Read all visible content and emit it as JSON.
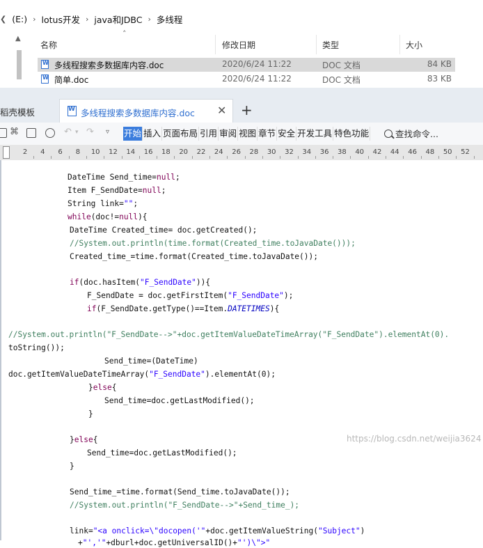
{
  "explorer": {
    "breadcrumb": [
      "(E:)",
      "lotus开发",
      "java和JDBC",
      "多线程"
    ],
    "columns": {
      "name": "名称",
      "date": "修改日期",
      "type": "类型",
      "size": "大小"
    },
    "files": [
      {
        "name": "多线程搜索多数据库内容.doc",
        "date": "2020/6/24 11:22",
        "type": "DOC 文档",
        "size": "84 KB",
        "selected": true
      },
      {
        "name": "简单.doc",
        "date": "2020/6/24 11:22",
        "type": "DOC 文档",
        "size": "83 KB",
        "selected": false
      }
    ]
  },
  "wps": {
    "tabs": {
      "template": "稻壳模板",
      "document": "多线程搜索多数据库内容.doc",
      "new_tab": "+"
    },
    "menu": [
      "开始",
      "插入",
      "页面布局",
      "引用",
      "审阅",
      "视图",
      "章节",
      "安全",
      "开发工具",
      "特色功能"
    ],
    "active_menu": "开始",
    "search_label": "查找命令...",
    "ruler_numbers": [
      "2",
      "4",
      "6",
      "8",
      "10",
      "12",
      "14",
      "16",
      "18",
      "20",
      "22",
      "24",
      "26",
      "28",
      "30",
      "32",
      "34",
      "36",
      "38",
      "40",
      "42",
      "44",
      "46",
      "48",
      "50",
      "52"
    ],
    "accent_color": "#3b7ddd"
  },
  "document": {
    "lines": [
      "DateTime Send_time=null;",
      "Item F_SendDate=null;",
      "String link=\"\";",
      "while(doc!=null){",
      "DateTime Created_time= doc.getCreated();",
      "//System.out.println(time.format(Created_time.toJavaDate()));",
      "Created_time_=time.format(Created_time.toJavaDate());",
      "if(doc.hasItem(\"F_SendDate\")){",
      "F_SendDate = doc.getFirstItem(\"F_SendDate\");",
      "if(F_SendDate.getType()==Item.DATETIMES){",
      "//System.out.println(\"F_SendDate-->\"+doc.getItemValueDateTimeArray(\"F_SendDate\").elementAt(0).",
      "toString());",
      "Send_time=(DateTime)",
      "doc.getItemValueDateTimeArray(\"F_SendDate\").elementAt(0);",
      "}else{",
      "Send_time=doc.getLastModified();",
      "}",
      "}else{",
      "Send_time=doc.getLastModified();",
      "}",
      "Send_time_=time.format(Send_time.toJavaDate());",
      "//System.out.println(\"F_SendDate-->\"+Send_time_);",
      "link=\"<a onclick=\\\"docopen('\"+doc.getItemValueString(\"Subject\")",
      "+\"','\"+dburl+doc.getUniversalID()+\"')\\\">\""
    ]
  },
  "watermark": "https://blog.csdn.net/weijia3624"
}
